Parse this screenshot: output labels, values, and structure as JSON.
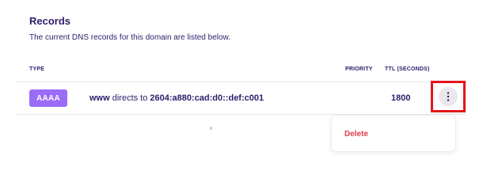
{
  "records": {
    "title": "Records",
    "description": "The current DNS records for this domain are listed below.",
    "columns": {
      "type": "TYPE",
      "priority": "PRIORITY",
      "ttl": "TTL (SECONDS)"
    },
    "rows": [
      {
        "type": "AAAA",
        "type_color": "#9b6cf7",
        "host": "www",
        "connector": " directs to ",
        "target": "2604:a880:cad:d0::def:c001",
        "priority": "",
        "ttl": "1800",
        "actions_icon": "more-vertical-icon"
      }
    ],
    "menu": {
      "items": [
        {
          "label": "Delete",
          "color": "#e0404a"
        }
      ]
    }
  },
  "colors": {
    "text": "#2f1c6a",
    "highlight": "#e3161c",
    "divider": "#e8e6ef"
  }
}
